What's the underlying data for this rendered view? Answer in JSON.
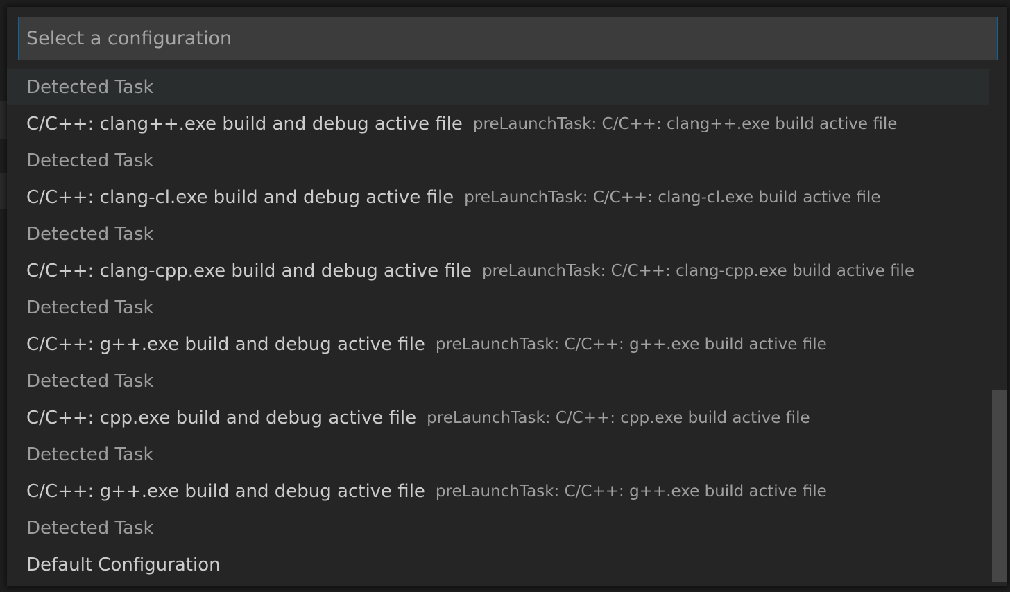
{
  "picker": {
    "placeholder": "Select a configuration",
    "value": ""
  },
  "items": [
    {
      "detail": "Detected Task"
    },
    {
      "label": "C/C++: clang++.exe build and debug active file",
      "description": "preLaunchTask: C/C++: clang++.exe build active file"
    },
    {
      "detail": "Detected Task"
    },
    {
      "label": "C/C++: clang-cl.exe build and debug active file",
      "description": "preLaunchTask: C/C++: clang-cl.exe build active file"
    },
    {
      "detail": "Detected Task"
    },
    {
      "label": "C/C++: clang-cpp.exe build and debug active file",
      "description": "preLaunchTask: C/C++: clang-cpp.exe build active file"
    },
    {
      "detail": "Detected Task"
    },
    {
      "label": "C/C++: g++.exe build and debug active file",
      "description": "preLaunchTask: C/C++: g++.exe build active file"
    },
    {
      "detail": "Detected Task"
    },
    {
      "label": "C/C++: cpp.exe build and debug active file",
      "description": "preLaunchTask: C/C++: cpp.exe build active file"
    },
    {
      "detail": "Detected Task"
    },
    {
      "label": "C/C++: g++.exe build and debug active file",
      "description": "preLaunchTask: C/C++: g++.exe build active file"
    },
    {
      "detail": "Detected Task"
    },
    {
      "label": "Default Configuration"
    }
  ],
  "colors": {
    "accent_border": "#0e639c",
    "panel_background": "#252526",
    "focused_row": "#2a2d2e"
  }
}
